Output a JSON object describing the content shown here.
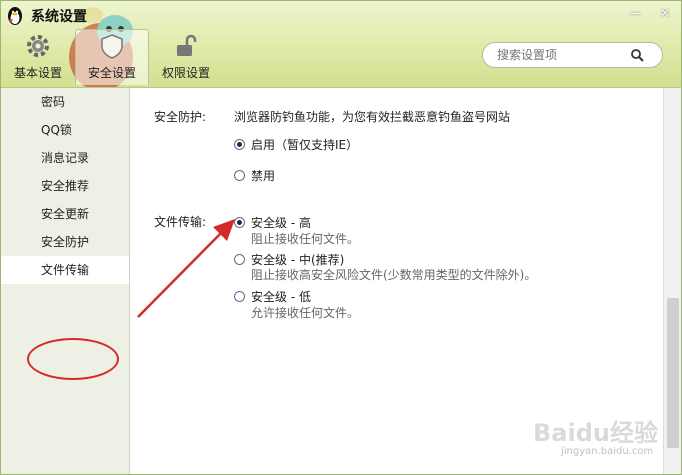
{
  "window": {
    "title": "系统设置"
  },
  "controls": {
    "minimize": "—",
    "close": "✕"
  },
  "tabs": [
    {
      "label": "基本设置",
      "icon": "gear-icon"
    },
    {
      "label": "安全设置",
      "icon": "shield-icon"
    },
    {
      "label": "权限设置",
      "icon": "lock-icon"
    }
  ],
  "search": {
    "placeholder": "搜索设置项"
  },
  "sidebar": {
    "items": [
      {
        "label": "密码"
      },
      {
        "label": "QQ锁"
      },
      {
        "label": "消息记录"
      },
      {
        "label": "安全推荐"
      },
      {
        "label": "安全更新"
      },
      {
        "label": "安全防护"
      },
      {
        "label": "文件传输"
      }
    ]
  },
  "main": {
    "protection": {
      "label": "安全防护:",
      "desc": "浏览器防钓鱼功能，为您有效拦截恶意钓鱼盗号网站",
      "options": [
        {
          "label": "启用（暂仅支持IE）",
          "checked": true
        },
        {
          "label": "禁用",
          "checked": false
        }
      ]
    },
    "transfer": {
      "label": "文件传输:",
      "options": [
        {
          "label": "安全级 - 高",
          "desc": "阻止接收任何文件。",
          "checked": true
        },
        {
          "label": "安全级 - 中(推荐)",
          "desc": "阻止接收高安全风险文件(少数常用类型的文件除外)。",
          "checked": false
        },
        {
          "label": "安全级 - 低",
          "desc": "允许接收任何文件。",
          "checked": false
        }
      ]
    }
  },
  "watermark": {
    "brand": "Baidu经验",
    "url": "jingyan.baidu.com"
  },
  "colors": {
    "annotation": "#d62a2a",
    "header": "#dfeaa9"
  }
}
